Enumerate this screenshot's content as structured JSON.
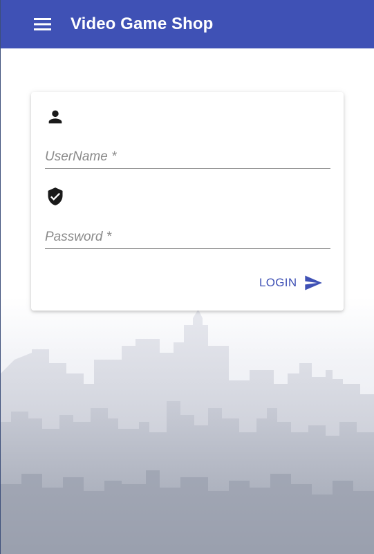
{
  "app": {
    "title": "Video Game Shop",
    "accent_color": "#3f51b5"
  },
  "toolbar": {
    "menu_icon": "hamburger-menu-icon"
  },
  "login_form": {
    "username": {
      "icon": "person-icon",
      "placeholder": "UserName *",
      "value": ""
    },
    "password": {
      "icon": "verified-shield-icon",
      "placeholder": "Password *",
      "value": ""
    },
    "submit": {
      "label": "LOGIN",
      "icon": "send-icon"
    }
  },
  "background": {
    "image": "city-skyline-silhouette"
  }
}
